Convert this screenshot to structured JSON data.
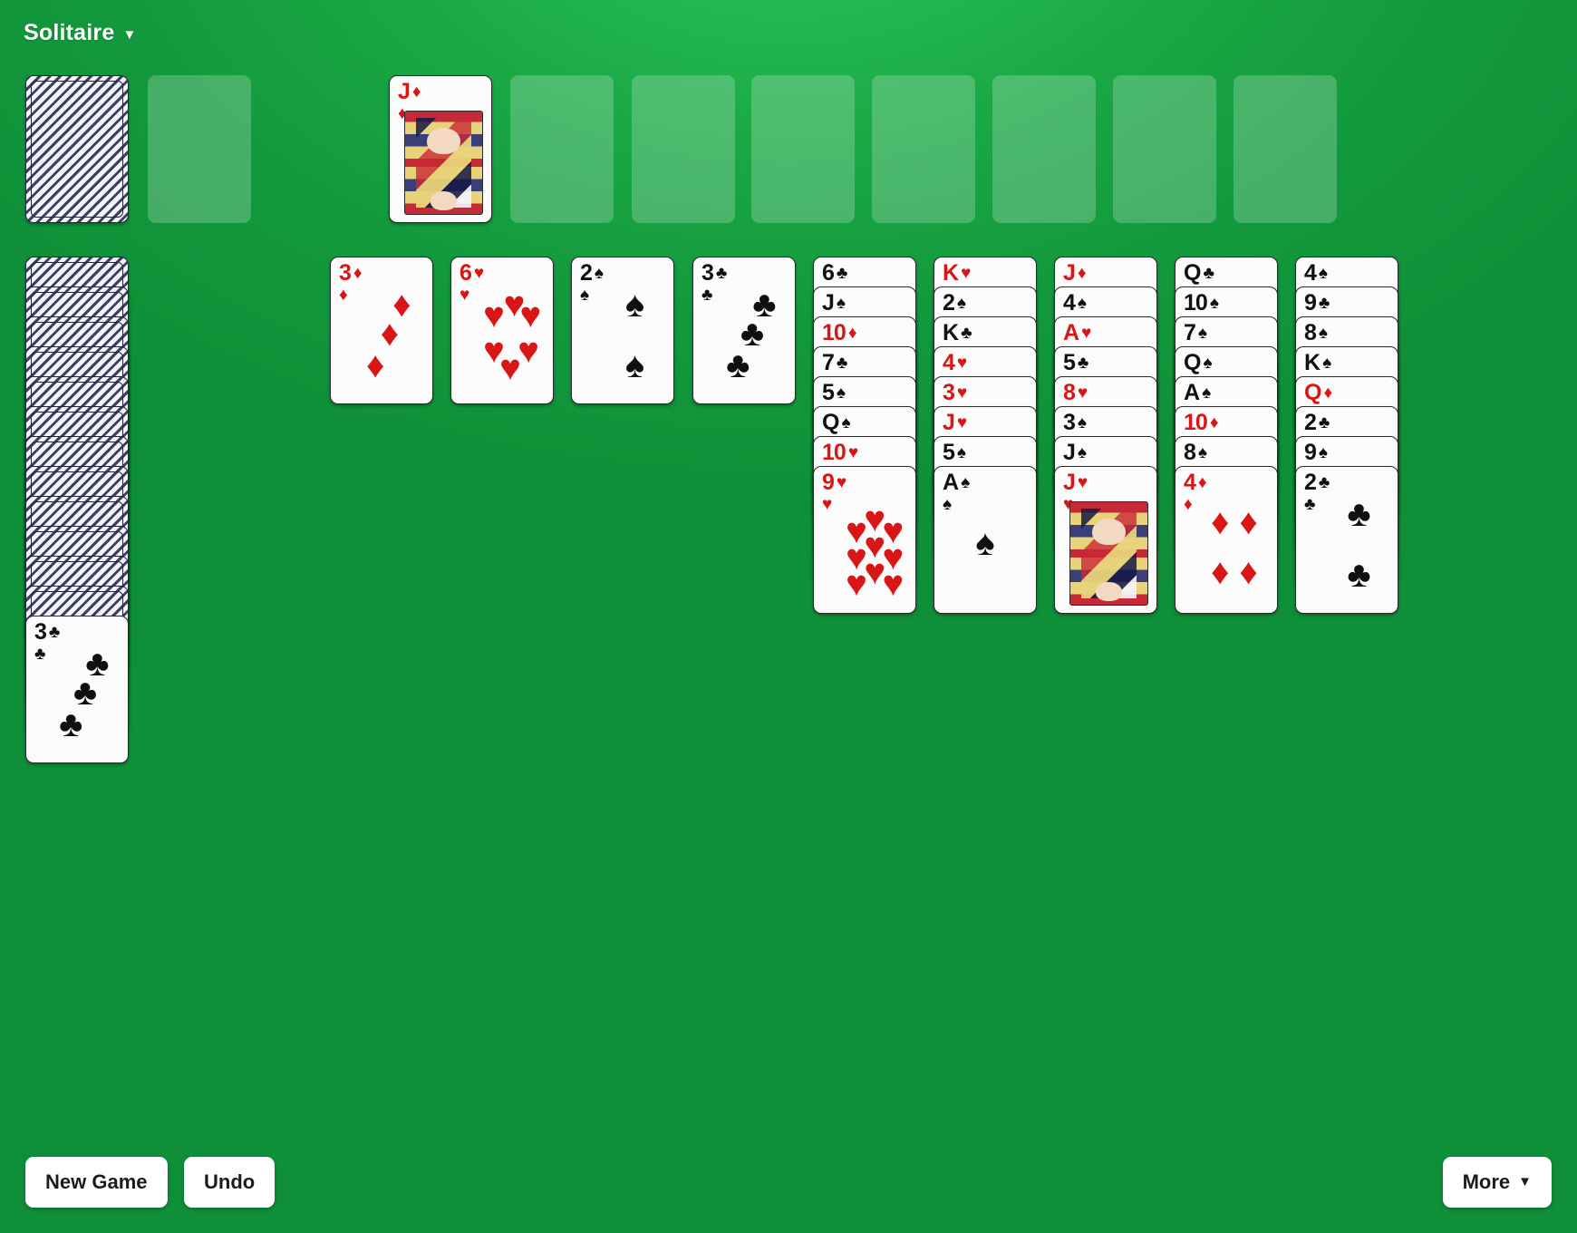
{
  "header": {
    "title": "Solitaire",
    "caret": "▼"
  },
  "buttons": {
    "new_game": "New Game",
    "undo": "Undo",
    "more": "More",
    "more_caret": "▼"
  },
  "colors": {
    "table_green": "#17a544",
    "red_suit": "#d81616",
    "black_suit": "#101010",
    "card_face": "#fbfbfb",
    "empty_slot": "rgba(255,255,255,0.22)"
  },
  "suits": {
    "spade": "♠",
    "heart": "♥",
    "diamond": "♦",
    "club": "♣"
  },
  "top_row": {
    "stock": {
      "type": "face-down",
      "name": "stock-pile"
    },
    "slots": [
      {
        "index": 0,
        "state": "empty"
      },
      {
        "index": 1,
        "state": "card",
        "rank": "J",
        "suit": "♦",
        "color": "red",
        "court": true
      },
      {
        "index": 2,
        "state": "empty"
      },
      {
        "index": 3,
        "state": "empty"
      },
      {
        "index": 4,
        "state": "empty"
      },
      {
        "index": 5,
        "state": "empty"
      },
      {
        "index": 6,
        "state": "empty"
      },
      {
        "index": 7,
        "state": "empty"
      },
      {
        "index": 8,
        "state": "empty"
      }
    ]
  },
  "draw_pile": {
    "facedown_count": 12,
    "top_card": {
      "rank": "3",
      "suit": "♣",
      "color": "black",
      "pips": 3
    }
  },
  "tableau": [
    {
      "column": 1,
      "facedown": 0,
      "cards": [
        {
          "rank": "3",
          "suit": "♦",
          "color": "red",
          "pips": 3,
          "exposed": true
        }
      ]
    },
    {
      "column": 2,
      "facedown": 0,
      "cards": [
        {
          "rank": "6",
          "suit": "♥",
          "color": "red",
          "pips": 6,
          "exposed": true
        }
      ]
    },
    {
      "column": 3,
      "facedown": 0,
      "cards": [
        {
          "rank": "2",
          "suit": "♠",
          "color": "black",
          "pips": 2,
          "exposed": true
        }
      ]
    },
    {
      "column": 4,
      "facedown": 0,
      "cards": [
        {
          "rank": "3",
          "suit": "♣",
          "color": "black",
          "pips": 3,
          "exposed": true
        }
      ]
    },
    {
      "column": 5,
      "facedown": 0,
      "cards": [
        {
          "rank": "6",
          "suit": "♣",
          "color": "black",
          "exposed": false
        },
        {
          "rank": "J",
          "suit": "♠",
          "color": "black",
          "exposed": false
        },
        {
          "rank": "10",
          "suit": "♦",
          "color": "red",
          "exposed": false
        },
        {
          "rank": "7",
          "suit": "♣",
          "color": "black",
          "exposed": false
        },
        {
          "rank": "5",
          "suit": "♠",
          "color": "black",
          "exposed": false
        },
        {
          "rank": "Q",
          "suit": "♠",
          "color": "black",
          "exposed": false
        },
        {
          "rank": "10",
          "suit": "♥",
          "color": "red",
          "exposed": false
        },
        {
          "rank": "9",
          "suit": "♥",
          "color": "red",
          "pips": 9,
          "exposed": true
        }
      ]
    },
    {
      "column": 6,
      "facedown": 0,
      "cards": [
        {
          "rank": "K",
          "suit": "♥",
          "color": "red",
          "exposed": false
        },
        {
          "rank": "2",
          "suit": "♠",
          "color": "black",
          "exposed": false
        },
        {
          "rank": "K",
          "suit": "♣",
          "color": "black",
          "exposed": false
        },
        {
          "rank": "4",
          "suit": "♥",
          "color": "red",
          "exposed": false
        },
        {
          "rank": "3",
          "suit": "♥",
          "color": "red",
          "exposed": false
        },
        {
          "rank": "J",
          "suit": "♥",
          "color": "red",
          "exposed": false
        },
        {
          "rank": "5",
          "suit": "♠",
          "color": "black",
          "exposed": false
        },
        {
          "rank": "A",
          "suit": "♠",
          "color": "black",
          "pips": 1,
          "exposed": true
        }
      ]
    },
    {
      "column": 7,
      "facedown": 0,
      "cards": [
        {
          "rank": "J",
          "suit": "♦",
          "color": "red",
          "exposed": false
        },
        {
          "rank": "4",
          "suit": "♠",
          "color": "black",
          "exposed": false
        },
        {
          "rank": "A",
          "suit": "♥",
          "color": "red",
          "exposed": false
        },
        {
          "rank": "5",
          "suit": "♣",
          "color": "black",
          "exposed": false
        },
        {
          "rank": "8",
          "suit": "♥",
          "color": "red",
          "exposed": false
        },
        {
          "rank": "3",
          "suit": "♠",
          "color": "black",
          "exposed": false
        },
        {
          "rank": "J",
          "suit": "♠",
          "color": "black",
          "exposed": false
        },
        {
          "rank": "J",
          "suit": "♥",
          "color": "red",
          "court": true,
          "exposed": true
        }
      ]
    },
    {
      "column": 8,
      "facedown": 0,
      "cards": [
        {
          "rank": "Q",
          "suit": "♣",
          "color": "black",
          "exposed": false
        },
        {
          "rank": "10",
          "suit": "♠",
          "color": "black",
          "exposed": false
        },
        {
          "rank": "7",
          "suit": "♠",
          "color": "black",
          "exposed": false
        },
        {
          "rank": "Q",
          "suit": "♠",
          "color": "black",
          "exposed": false
        },
        {
          "rank": "A",
          "suit": "♠",
          "color": "black",
          "exposed": false
        },
        {
          "rank": "10",
          "suit": "♦",
          "color": "red",
          "exposed": false
        },
        {
          "rank": "8",
          "suit": "♠",
          "color": "black",
          "exposed": false
        },
        {
          "rank": "4",
          "suit": "♦",
          "color": "red",
          "pips": 4,
          "exposed": true
        }
      ]
    },
    {
      "column": 9,
      "facedown": 0,
      "cards": [
        {
          "rank": "4",
          "suit": "♠",
          "color": "black",
          "exposed": false
        },
        {
          "rank": "9",
          "suit": "♣",
          "color": "black",
          "exposed": false
        },
        {
          "rank": "8",
          "suit": "♠",
          "color": "black",
          "exposed": false
        },
        {
          "rank": "K",
          "suit": "♠",
          "color": "black",
          "exposed": false
        },
        {
          "rank": "Q",
          "suit": "♦",
          "color": "red",
          "exposed": false
        },
        {
          "rank": "2",
          "suit": "♣",
          "color": "black",
          "exposed": false
        },
        {
          "rank": "9",
          "suit": "♠",
          "color": "black",
          "exposed": false
        },
        {
          "rank": "2",
          "suit": "♣",
          "color": "black",
          "pips": 2,
          "exposed": true
        }
      ]
    }
  ]
}
